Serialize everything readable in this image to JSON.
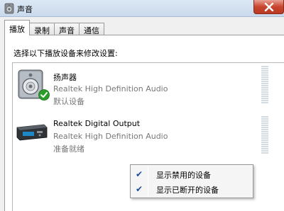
{
  "window": {
    "title": "声音",
    "close_icon": "close-icon",
    "app_icon": "speaker-icon"
  },
  "tabs": [
    {
      "label": "播放",
      "active": true
    },
    {
      "label": "录制",
      "active": false
    },
    {
      "label": "声音",
      "active": false
    },
    {
      "label": "通信",
      "active": false
    }
  ],
  "panel": {
    "instruction": "选择以下播放设备来修改设置:"
  },
  "devices": [
    {
      "name": "扬声器",
      "description": "Realtek High Definition Audio",
      "status": "默认设备",
      "icon": "speaker-icon",
      "is_default": true
    },
    {
      "name": "Realtek Digital Output",
      "description": "Realtek High Definition Audio",
      "status": "准备就绪",
      "icon": "digital-output-icon",
      "is_default": false
    }
  ],
  "context_menu": {
    "items": [
      {
        "label": "显示禁用的设备",
        "checked": true
      },
      {
        "label": "显示已断开的设备",
        "checked": true
      }
    ]
  },
  "colors": {
    "default_check": "#2a9d2a",
    "menu_check": "#1a4a9a",
    "close_button": "#c8452f"
  }
}
